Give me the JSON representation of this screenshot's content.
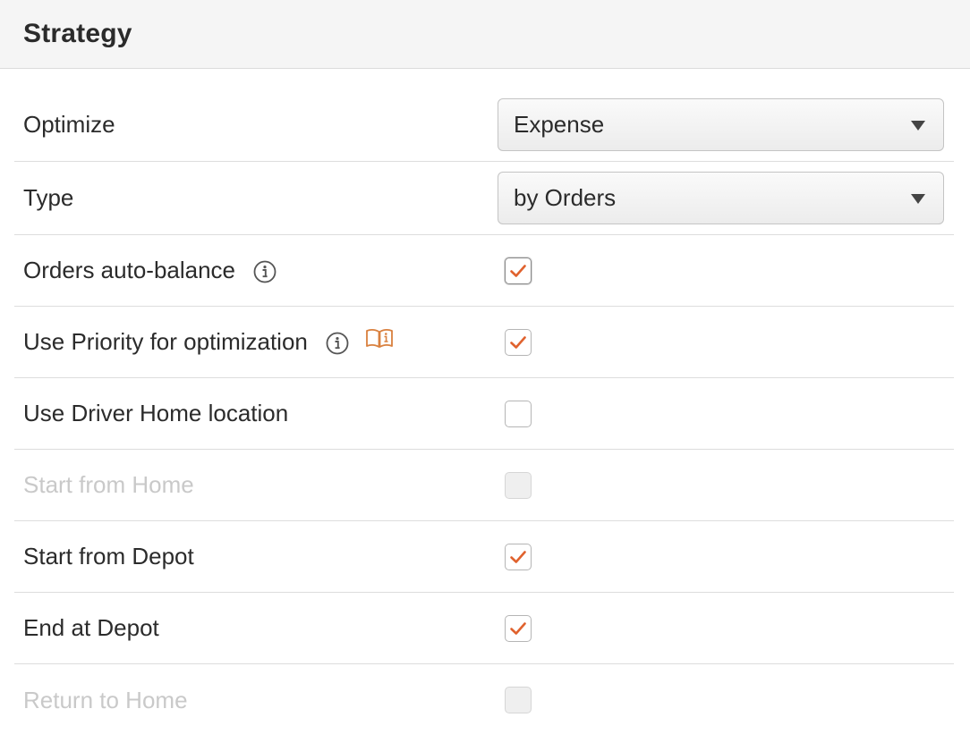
{
  "panel": {
    "title": "Strategy"
  },
  "colors": {
    "accent_check": "#e0622e",
    "book_icon": "#d9803e",
    "disabled_text": "#c9c9c9"
  },
  "rows": {
    "optimize": {
      "label": "Optimize",
      "value": "Expense"
    },
    "type": {
      "label": "Type",
      "value": "by Orders"
    },
    "orders_auto_balance": {
      "label": "Orders auto-balance",
      "checked": true,
      "icon": "info-circle-icon"
    },
    "use_priority": {
      "label": "Use Priority for optimization",
      "checked": true,
      "icons": [
        "info-circle-icon",
        "book-info-icon"
      ]
    },
    "use_driver_home": {
      "label": "Use Driver Home location",
      "checked": false
    },
    "start_from_home": {
      "label": "Start from Home",
      "checked": false,
      "disabled": true
    },
    "start_from_depot": {
      "label": "Start from Depot",
      "checked": true
    },
    "end_at_depot": {
      "label": "End at Depot",
      "checked": true
    },
    "return_to_home": {
      "label": "Return to Home",
      "checked": false,
      "disabled": true
    }
  }
}
